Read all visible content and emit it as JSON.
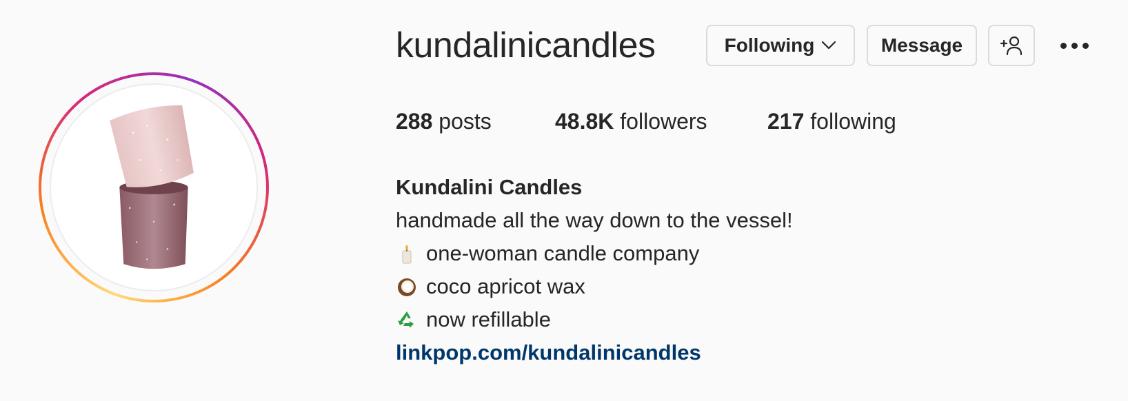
{
  "profile": {
    "username": "kundalinicandles",
    "buttons": {
      "following_label": "Following",
      "message_label": "Message"
    },
    "stats": {
      "posts_count": "288",
      "posts_label": "posts",
      "followers_count": "48.8K",
      "followers_label": "followers",
      "following_count": "217",
      "following_label": "following"
    },
    "bio": {
      "name": "Kundalini Candles",
      "lines": [
        {
          "icon": "candle-icon",
          "text": "handmade all the way down to the vessel!"
        },
        {
          "icon": "candle-icon",
          "text": "one-woman candle company"
        },
        {
          "icon": "coconut-icon",
          "text": "coco apricot wax"
        },
        {
          "icon": "recycle-icon",
          "text": "now refillable"
        }
      ],
      "link": "linkpop.com/kundalinicandles"
    }
  },
  "colors": {
    "background": "#fafafa",
    "text": "#262626",
    "link": "#00376b",
    "button_border": "#dbdbdb"
  }
}
